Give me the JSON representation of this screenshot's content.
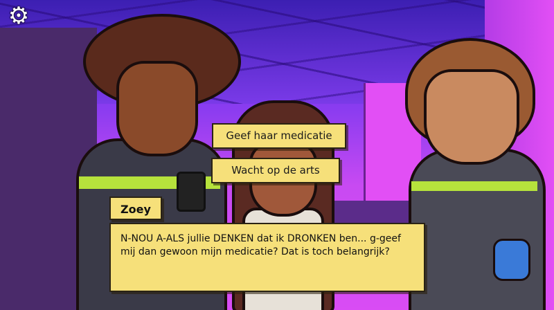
{
  "settings": {
    "icon": "gear-icon"
  },
  "choices": [
    {
      "label": "Geef haar medicatie"
    },
    {
      "label": "Wacht op de arts"
    }
  ],
  "dialogue": {
    "speaker": "Zoey",
    "text": "N-NOU A-ALS jullie DENKEN dat ik DRONKEN ben... g-geef mij dan gewoon mijn medicatie? Dat is toch belangrijk?"
  },
  "colors": {
    "panel": "#f6e07a",
    "accent_stripe": "#b6e23c",
    "background": "#c84af2"
  }
}
